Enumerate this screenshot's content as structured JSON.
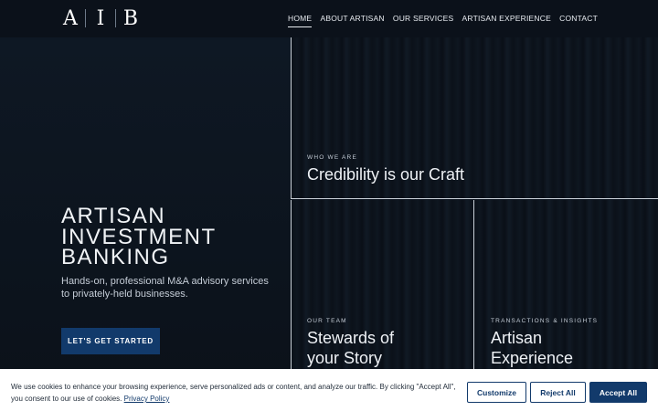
{
  "header": {
    "logo": {
      "letters": [
        "A",
        "I",
        "B"
      ]
    },
    "nav": [
      {
        "label": "HOME",
        "active": true
      },
      {
        "label": "ABOUT ARTISAN",
        "active": false
      },
      {
        "label": "OUR SERVICES",
        "active": false
      },
      {
        "label": "ARTISAN EXPERIENCE",
        "active": false
      },
      {
        "label": "CONTACT",
        "active": false
      }
    ]
  },
  "hero": {
    "title_lines": [
      "ARTISAN",
      "INVESTMENT",
      "BANKING"
    ],
    "subtitle": "Hands-on, professional M&A advisory services to privately-held businesses.",
    "cta_label": "LET'S GET STARTED"
  },
  "panels": {
    "who": {
      "eyebrow": "WHO WE ARE",
      "title": "Credibility is our Craft"
    },
    "team": {
      "eyebrow": "OUR TEAM",
      "title": "Stewards of your Story"
    },
    "transactions": {
      "eyebrow": "TRANSACTIONS & INSIGHTS",
      "title": "Artisan Experience"
    }
  },
  "cookie": {
    "text": "We use cookies to enhance your browsing experience, serve personalized ads or content, and analyze our traffic. By clicking \"Accept All\", you consent to our use of cookies.",
    "link_label": "Privacy Policy",
    "customize_label": "Customize",
    "reject_label": "Reject All",
    "accept_label": "Accept All"
  },
  "colors": {
    "accent": "#123a6b",
    "background": "#0d1520"
  }
}
